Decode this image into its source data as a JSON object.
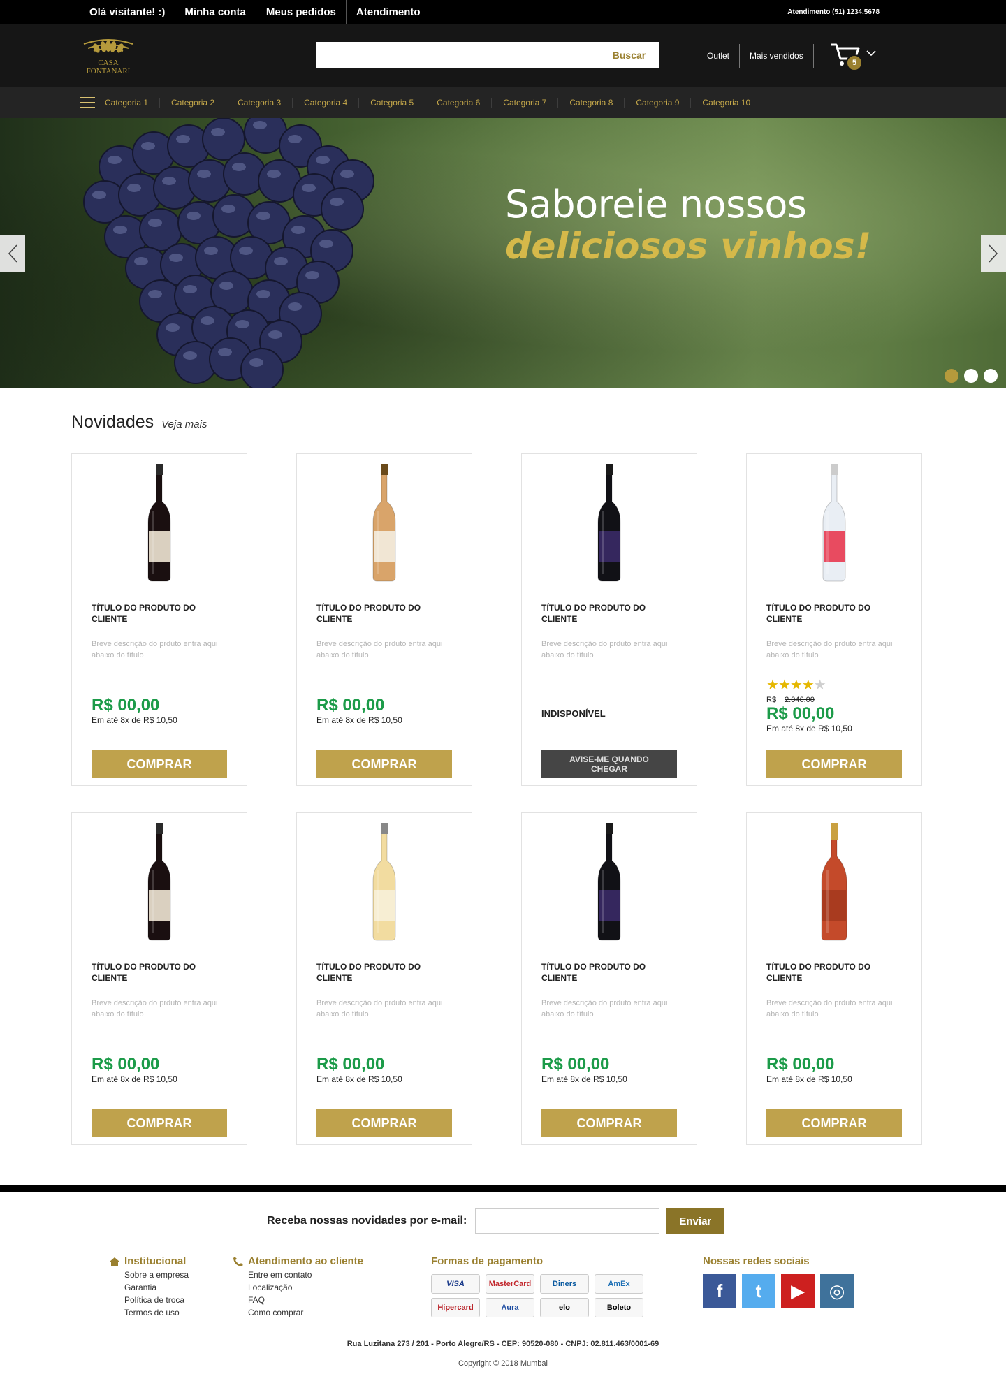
{
  "topbar": {
    "greeting": "Olá visitante! :)",
    "account": "Minha conta",
    "orders": "Meus pedidos",
    "support": "Atendimento",
    "phone": "Atendimento (51) 1234.5678"
  },
  "header": {
    "logo_line1": "CASA",
    "logo_line2": "FONTANARI",
    "search_placeholder": "",
    "search_button": "Buscar",
    "outlet": "Outlet",
    "best_sellers": "Mais vendidos",
    "cart_count": "5"
  },
  "categories": [
    "Categoria 1",
    "Categoria 2",
    "Categoria 3",
    "Categoria 4",
    "Categoria 5",
    "Categoria 6",
    "Categoria 7",
    "Categoria 8",
    "Categoria 9",
    "Categoria 10"
  ],
  "hero": {
    "line1": "Saboreie nossos",
    "line2": "deliciosos vinhos!"
  },
  "section": {
    "title": "Novidades",
    "more": "Veja mais"
  },
  "products": [
    {
      "title": "Título do produto do cliente",
      "desc": "Breve descrição do prduto entra aqui abaixo do título",
      "price": "R$ 00,00",
      "inst": "Em até 8x de R$ 10,50",
      "button": "Comprar",
      "bottle": "red"
    },
    {
      "title": "Título do produto do cliente",
      "desc": "Breve descrição do prduto entra aqui abaixo do título",
      "price": "R$ 00,00",
      "inst": "Em até 8x de R$ 10,50",
      "button": "Comprar",
      "bottle": "amber"
    },
    {
      "title": "Título do produto do cliente",
      "desc": "Breve descrição do prduto entra aqui abaixo do título",
      "status": "INDISPONÍVEL",
      "button": "Avise-me quando chegar",
      "bottle": "dark"
    },
    {
      "title": "Título do produto do cliente",
      "desc": "Breve descrição do prduto entra aqui abaixo do título",
      "rating": 4,
      "old_label": "R$",
      "old_price": "2.046,00",
      "price": "R$ 00,00",
      "inst": "Em até 8x de R$ 10,50",
      "button": "Comprar",
      "bottle": "clear"
    },
    {
      "title": "Título do produto do cliente",
      "desc": "Breve descrição do prduto entra aqui abaixo do título",
      "price": "R$ 00,00",
      "inst": "Em até 8x de R$ 10,50",
      "button": "Comprar",
      "bottle": "red"
    },
    {
      "title": "Título do produto do cliente",
      "desc": "Breve descrição do prduto entra aqui abaixo do título",
      "price": "R$ 00,00",
      "inst": "Em até 8x de R$ 10,50",
      "button": "Comprar",
      "bottle": "pisco"
    },
    {
      "title": "Título do produto do cliente",
      "desc": "Breve descrição do prduto entra aqui abaixo do título",
      "price": "R$ 00,00",
      "inst": "Em até 8x de R$ 10,50",
      "button": "Comprar",
      "bottle": "dark"
    },
    {
      "title": "Título do produto do cliente",
      "desc": "Breve descrição do prduto entra aqui abaixo do título",
      "price": "R$ 00,00",
      "inst": "Em até 8x de R$ 10,50",
      "button": "Comprar",
      "bottle": "rose"
    }
  ],
  "footer": {
    "newsletter_label": "Receba nossas novidades por e-mail:",
    "newsletter_button": "Enviar",
    "institutional_title": "Institucional",
    "institutional_links": [
      "Sobre a empresa",
      "Garantia",
      "Política de troca",
      "Termos de uso"
    ],
    "service_title": "Atendimento ao cliente",
    "service_links": [
      "Entre em contato",
      "Localização",
      "FAQ",
      "Como comprar"
    ],
    "payment_title": "Formas de pagamento",
    "payment_methods": [
      "VISA",
      "MasterCard",
      "Diners",
      "AmEx",
      "Hipercard",
      "Aura",
      "elo",
      "Boleto"
    ],
    "social_title": "Nossas redes sociais",
    "social": [
      "facebook",
      "twitter",
      "youtube",
      "instagram"
    ],
    "address": "Rua Luzitana 273 / 201 - Porto Alegre/RS - CEP: 90520-080 - CNPJ: 02.811.463/0001-69",
    "copyright": "Copyright © 2018 Mumbai"
  },
  "colors": {
    "gold": "#bfa24c",
    "price_green": "#1c9b49",
    "topbar": "#000000",
    "header": "#161616"
  }
}
